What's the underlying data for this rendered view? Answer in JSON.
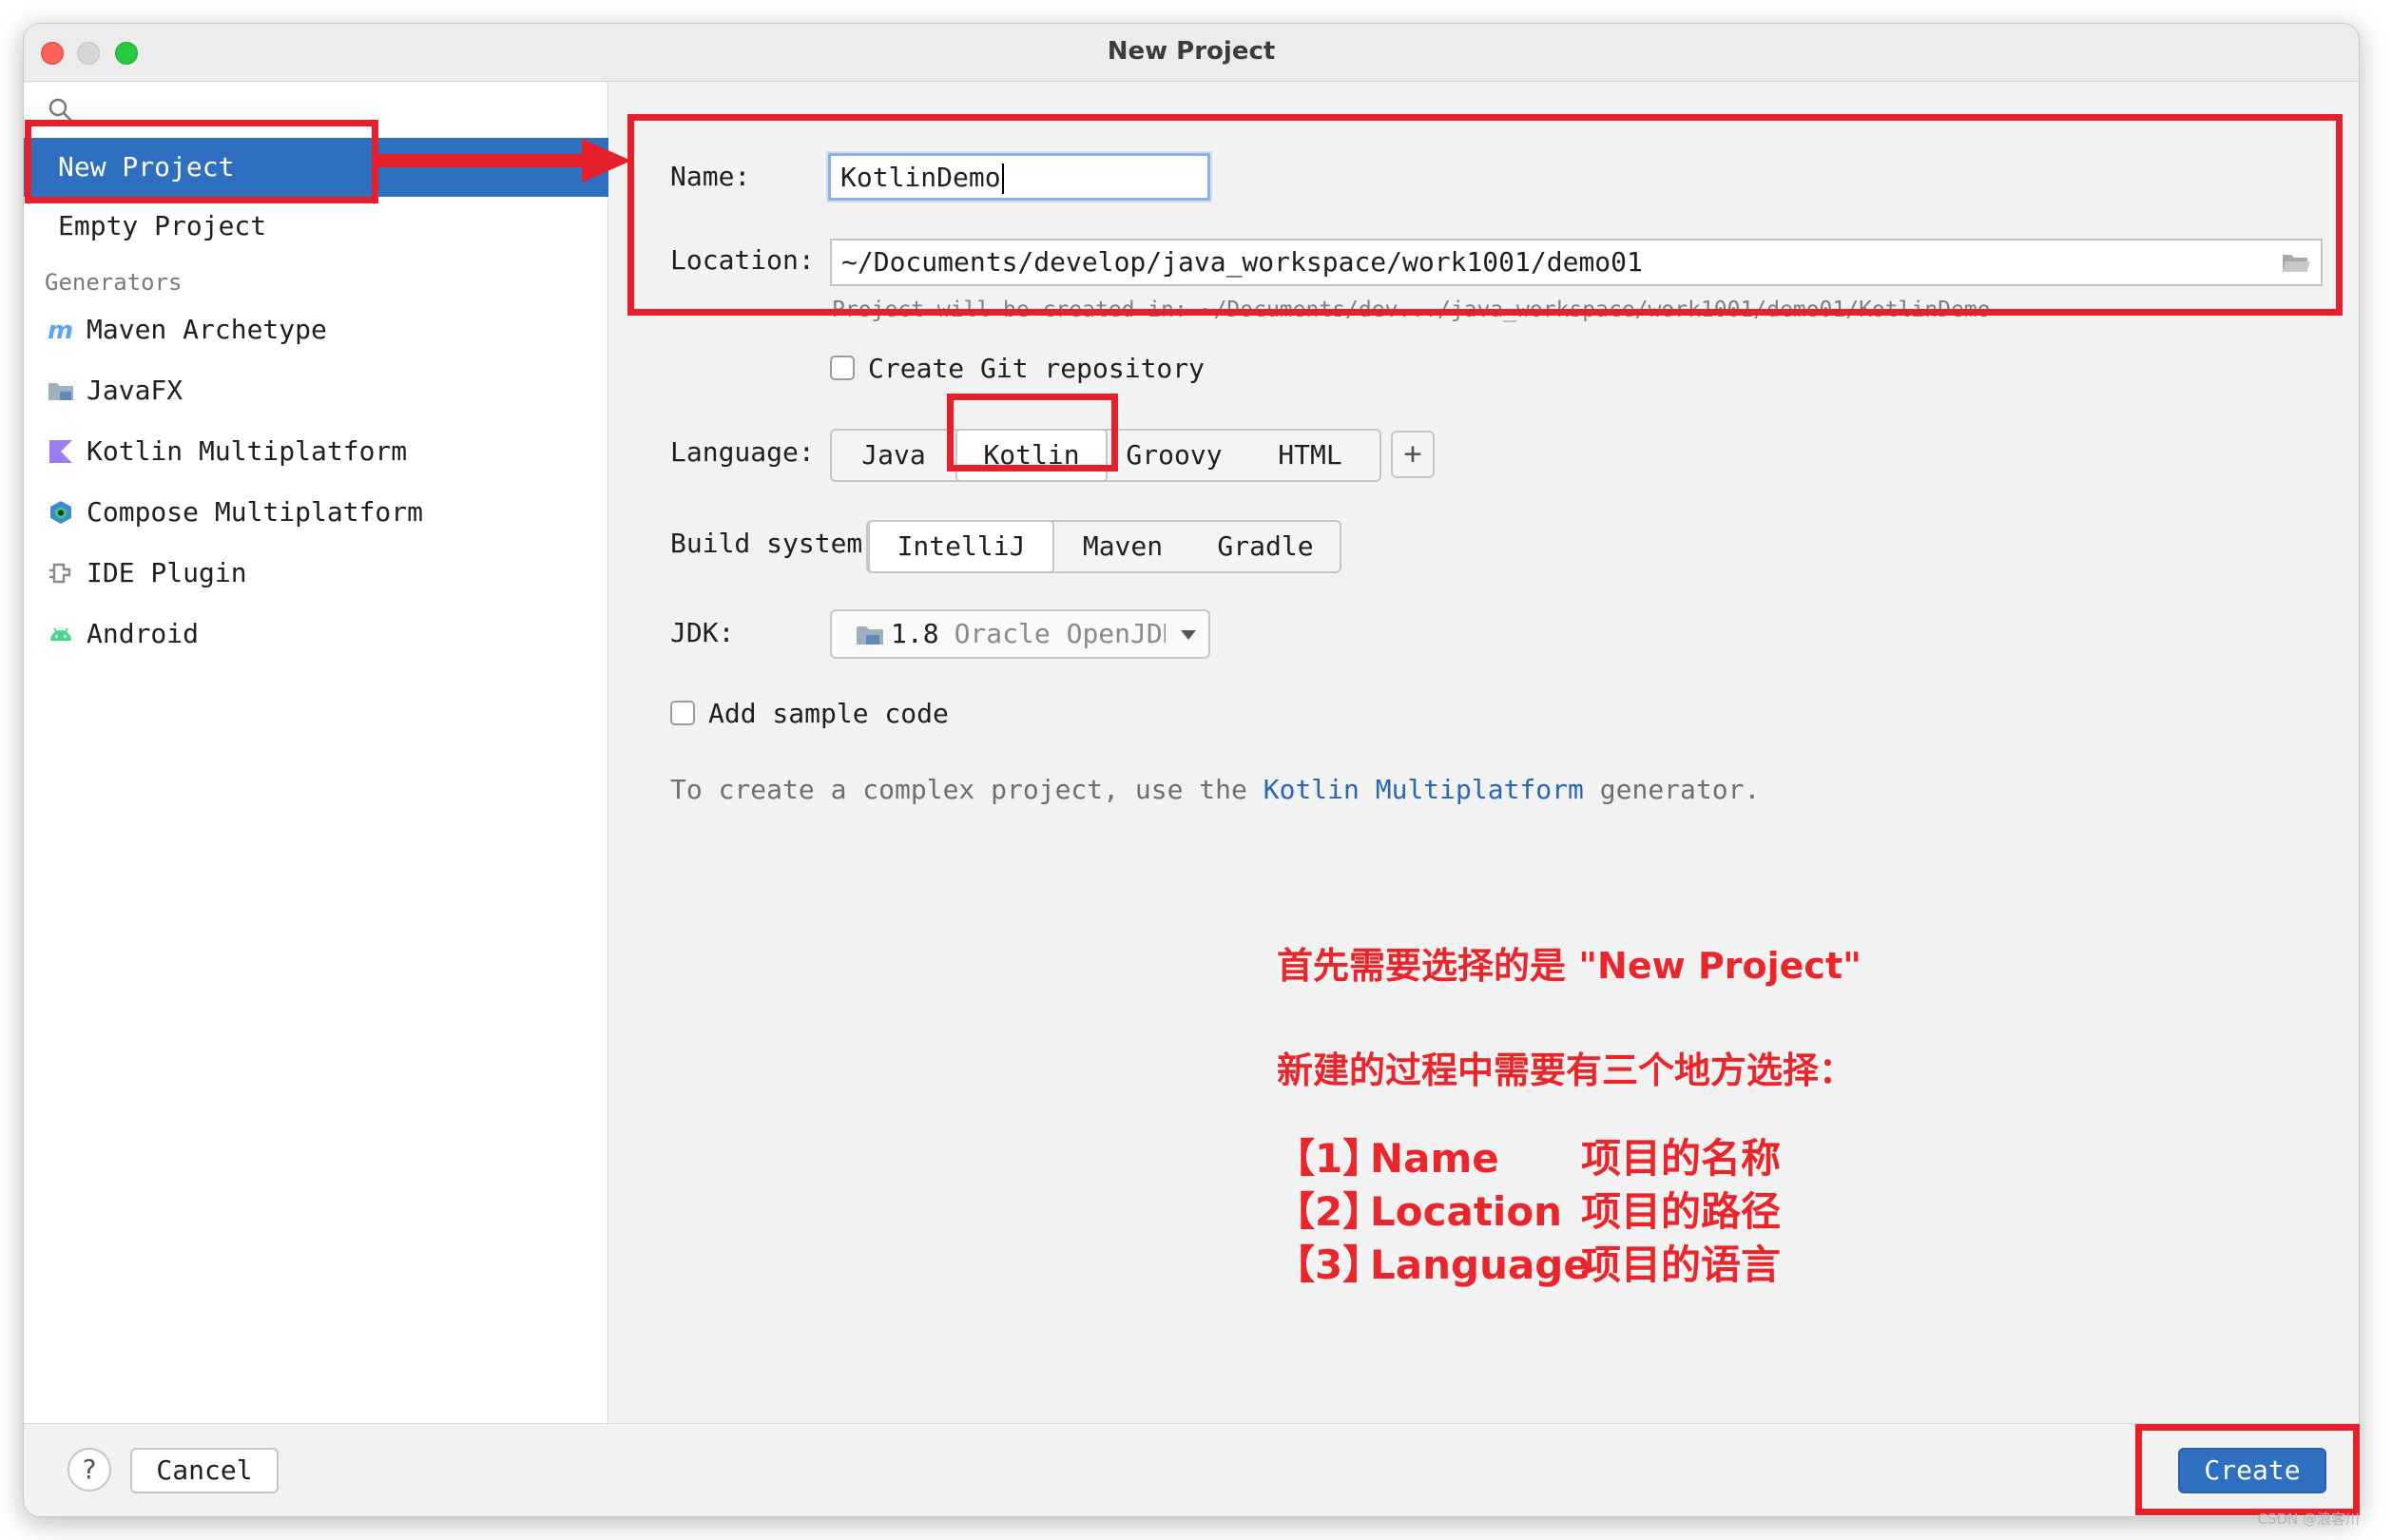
{
  "window": {
    "title": "New Project"
  },
  "sidebar": {
    "items": [
      {
        "label": "New Project"
      },
      {
        "label": "Empty Project"
      }
    ],
    "generators_header": "Generators",
    "generators": [
      {
        "label": "Maven Archetype",
        "icon": "maven-icon"
      },
      {
        "label": "JavaFX",
        "icon": "javafx-folder-icon"
      },
      {
        "label": "Kotlin Multiplatform",
        "icon": "kotlin-icon"
      },
      {
        "label": "Compose Multiplatform",
        "icon": "compose-icon"
      },
      {
        "label": "IDE Plugin",
        "icon": "plugin-icon"
      },
      {
        "label": "Android",
        "icon": "android-icon"
      }
    ]
  },
  "form": {
    "name_label": "Name:",
    "name_value": "KotlinDemo",
    "location_label": "Location:",
    "location_value": "~/Documents/develop/java_workspace/work1001/demo01",
    "location_hint": "Project will be created in: ~/Documents/dev.../java_workspace/work1001/demo01/KotlinDemo",
    "git_label": "Create Git repository",
    "language_label": "Language:",
    "languages": [
      "Java",
      "Kotlin",
      "Groovy",
      "HTML"
    ],
    "language_selected": "Kotlin",
    "add_language": "+",
    "build_label": "Build system:",
    "build_systems": [
      "IntelliJ",
      "Maven",
      "Gradle"
    ],
    "build_selected": "IntelliJ",
    "jdk_label": "JDK:",
    "jdk_version": "1.8",
    "jdk_vendor": "Oracle OpenJDK",
    "sample_label": "Add sample code",
    "info_prefix": "To create a complex project, use the ",
    "info_link": "Kotlin Multiplatform",
    "info_suffix": " generator."
  },
  "annotation": {
    "line1": "首先需要选择的是 \"New Project\"",
    "line2": "新建的过程中需要有三个地方选择：",
    "items": [
      {
        "index": "【1】",
        "key": "Name",
        "desc": "项目的名称"
      },
      {
        "index": "【2】",
        "key": "Location",
        "desc": "项目的路径"
      },
      {
        "index": "【3】",
        "key": "Language",
        "desc": "项目的语言"
      }
    ]
  },
  "footer": {
    "help": "?",
    "cancel": "Cancel",
    "create": "Create"
  },
  "watermark": "CSDN @浪客川",
  "colors": {
    "accent": "#2f6fbf",
    "annotation_red": "#e5202a",
    "link": "#2767b8"
  }
}
